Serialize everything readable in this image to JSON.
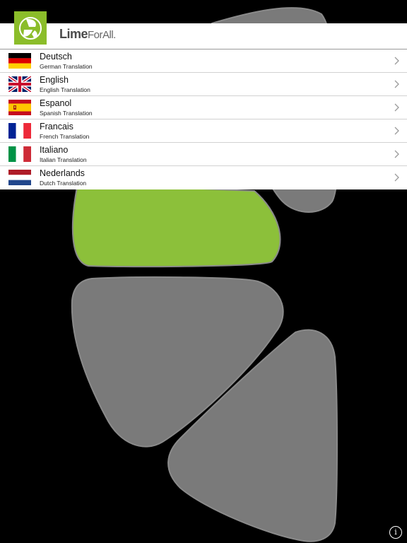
{
  "header": {
    "brand_bold": "Lime",
    "brand_light": "ForAll."
  },
  "languages": [
    {
      "label": "Deutsch",
      "subtitle": "German Translation",
      "flag": "de-flag-icon"
    },
    {
      "label": "English",
      "subtitle": "English Translation",
      "flag": "uk-flag-icon"
    },
    {
      "label": "Espanol",
      "subtitle": "Spanish Translation",
      "flag": "es-flag-icon"
    },
    {
      "label": "Francais",
      "subtitle": "French Translation",
      "flag": "fr-flag-icon"
    },
    {
      "label": "Italiano",
      "subtitle": "Italian Translation",
      "flag": "it-flag-icon"
    },
    {
      "label": "Nederlands",
      "subtitle": "Dutch Translation",
      "flag": "nl-flag-icon"
    }
  ],
  "info_button": "i",
  "colors": {
    "lime_green": "#8bbd2a",
    "segment_gray": "#7a7a7a",
    "background": "#000000"
  }
}
